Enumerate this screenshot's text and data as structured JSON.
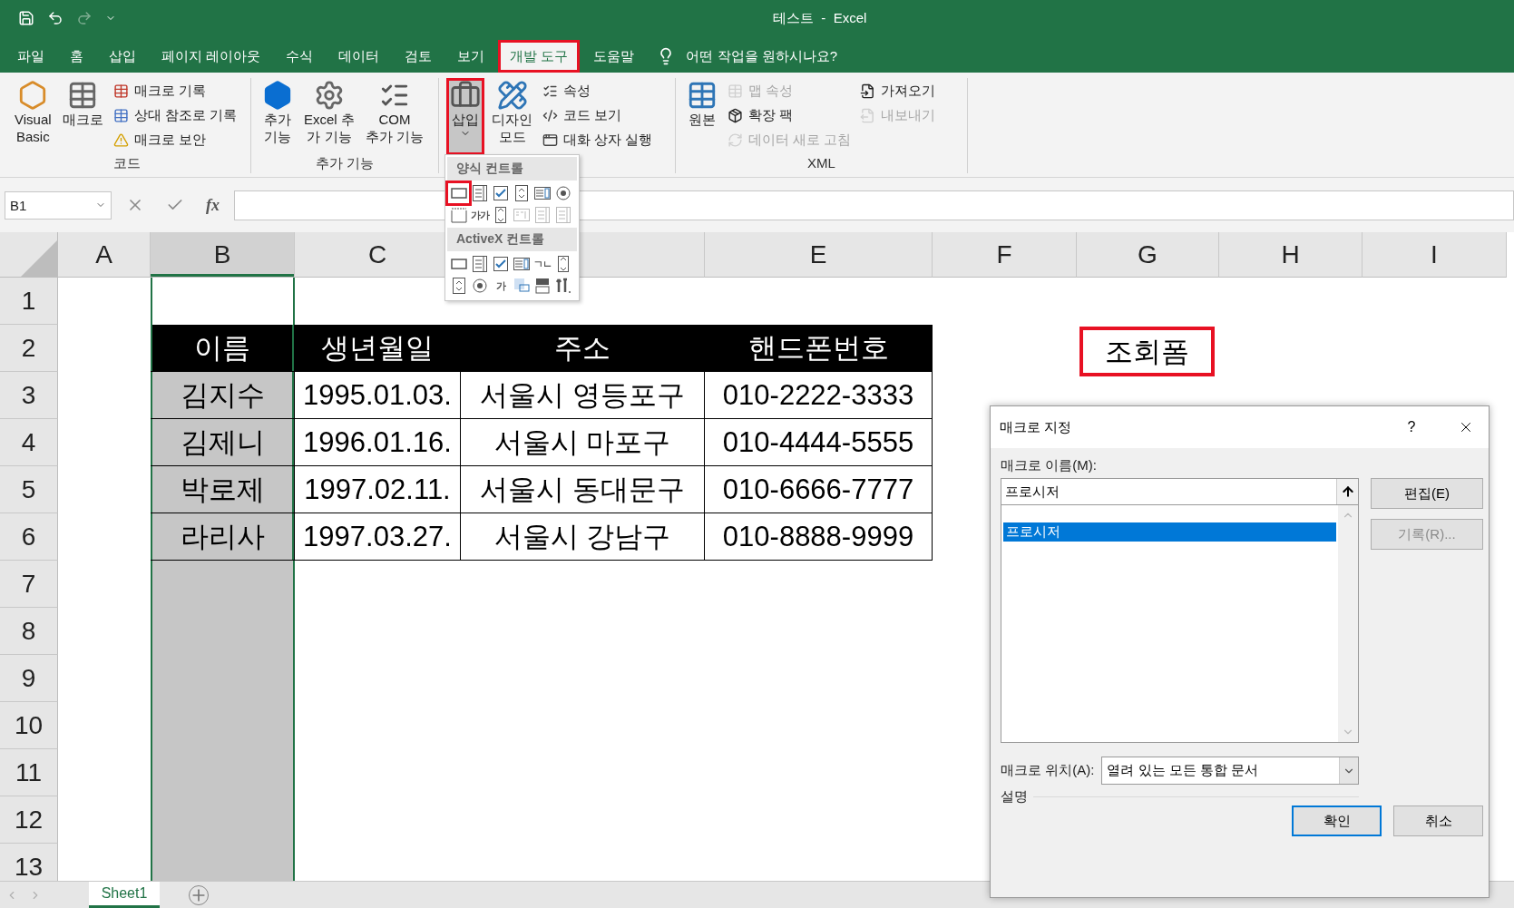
{
  "title_bar": {
    "title": "테스트  -  Excel"
  },
  "menu_tabs": [
    {
      "label": "파일",
      "selected": false,
      "highlighted": false
    },
    {
      "label": "홈",
      "selected": false,
      "highlighted": false
    },
    {
      "label": "삽입",
      "selected": false,
      "highlighted": false
    },
    {
      "label": "페이지 레이아웃",
      "selected": false,
      "highlighted": false
    },
    {
      "label": "수식",
      "selected": false,
      "highlighted": false
    },
    {
      "label": "데이터",
      "selected": false,
      "highlighted": false
    },
    {
      "label": "검토",
      "selected": false,
      "highlighted": false
    },
    {
      "label": "보기",
      "selected": false,
      "highlighted": false
    },
    {
      "label": "개발 도구",
      "selected": true,
      "highlighted": true
    },
    {
      "label": "도움말",
      "selected": false,
      "highlighted": false
    }
  ],
  "tell_me": "어떤 작업을 원하시나요?",
  "ribbon_groups": [
    {
      "label": "코드",
      "columns": [
        {
          "kind": "large",
          "label": "Visual\nBasic"
        },
        {
          "kind": "large",
          "label": "매크로"
        },
        {
          "kind": "stack",
          "items": [
            {
              "label": "매크로 기록",
              "disabled": false
            },
            {
              "label": "상대 참조로 기록",
              "disabled": false
            },
            {
              "label": "매크로 보안",
              "disabled": false
            }
          ]
        }
      ]
    },
    {
      "label": "추가 기능",
      "columns": [
        {
          "kind": "large",
          "label": "추가\n기능"
        },
        {
          "kind": "large",
          "label": "Excel 추\n가 기능"
        },
        {
          "kind": "large",
          "label": "COM\n추가 기능"
        }
      ]
    },
    {
      "columns": [
        {
          "kind": "large",
          "label": "삽입",
          "dropdown": true,
          "pressed": true,
          "highlighted": true
        },
        {
          "kind": "large",
          "label": "디자인\n모드"
        },
        {
          "kind": "stack",
          "items": [
            {
              "label": "속성",
              "disabled": false
            },
            {
              "label": "코드 보기",
              "disabled": false
            },
            {
              "label": "대화 상자 실행",
              "disabled": false
            }
          ]
        }
      ]
    },
    {
      "label": "XML",
      "columns": [
        {
          "kind": "large",
          "label": "원본"
        },
        {
          "kind": "stack",
          "items": [
            {
              "label": "맵 속성",
              "disabled": true
            },
            {
              "label": "확장 팩",
              "disabled": false
            },
            {
              "label": "데이터 새로 고침",
              "disabled": true
            }
          ]
        },
        {
          "kind": "stack",
          "items": [
            {
              "label": "가져오기",
              "disabled": false
            },
            {
              "label": "내보내기",
              "disabled": true
            }
          ]
        }
      ]
    }
  ],
  "formula_bar": {
    "name_box": "B1",
    "fx": "fx"
  },
  "sheet": {
    "columns": [
      {
        "label": "A",
        "selected": false
      },
      {
        "label": "B",
        "selected": true
      },
      {
        "label": "C",
        "selected": false
      },
      {
        "selected": false
      },
      {
        "label": "E",
        "selected": false
      },
      {
        "label": "F",
        "selected": false
      },
      {
        "label": "G",
        "selected": false
      },
      {
        "label": "H",
        "selected": false
      },
      {
        "label": "I",
        "selected": false
      }
    ],
    "rows": [
      "1",
      "2",
      "3",
      "4",
      "5",
      "6",
      "7",
      "8",
      "9",
      "10",
      "11",
      "12",
      "13"
    ],
    "table": {
      "header": [
        "이름",
        "생년월일",
        "주소",
        "핸드폰번호"
      ],
      "rows": [
        [
          "김지수",
          "1995.01.03.",
          "서울시 영등포구",
          "010-2222-3333"
        ],
        [
          "김제니",
          "1996.01.16.",
          "서울시 마포구",
          "010-4444-5555"
        ],
        [
          "박로제",
          "1997.02.11.",
          "서울시 동대문구",
          "010-6666-7777"
        ],
        [
          "라리사",
          "1997.03.27.",
          "서울시 강남구",
          "010-8888-9999"
        ]
      ]
    },
    "form_button": {
      "label": "조회폼",
      "highlighted": true
    }
  },
  "insert_menu": {
    "sections": [
      {
        "title": "양식 컨트롤",
        "controls": [
          {
            "kind": "button",
            "disabled": false,
            "highlighted": true
          },
          {
            "kind": "combo",
            "disabled": false,
            "highlighted": false
          },
          {
            "kind": "checkbox",
            "disabled": false,
            "highlighted": false
          },
          {
            "kind": "spin",
            "disabled": false,
            "highlighted": false
          },
          {
            "kind": "listbox",
            "disabled": false,
            "highlighted": false
          },
          {
            "kind": "option",
            "disabled": false,
            "highlighted": false
          },
          {
            "kind": "group",
            "disabled": false,
            "highlighted": false
          },
          {
            "kind": "label",
            "glyph": "가가",
            "disabled": false,
            "highlighted": false
          },
          {
            "kind": "scroll",
            "disabled": false,
            "highlighted": false
          },
          {
            "kind": "textbox",
            "disabled": true,
            "highlighted": false
          },
          {
            "kind": "combo",
            "disabled": true,
            "highlighted": false
          },
          {
            "kind": "combo",
            "disabled": true,
            "highlighted": false
          }
        ]
      },
      {
        "title": "ActiveX 컨트롤",
        "controls": [
          {
            "kind": "button",
            "disabled": false,
            "highlighted": false
          },
          {
            "kind": "combo",
            "disabled": false,
            "highlighted": false
          },
          {
            "kind": "checkbox",
            "disabled": false,
            "highlighted": false
          },
          {
            "kind": "listbox",
            "disabled": false,
            "highlighted": false
          },
          {
            "kind": "textbox",
            "glyph": "ㄱㄴ",
            "disabled": false,
            "highlighted": false
          },
          {
            "kind": "scroll",
            "disabled": false,
            "highlighted": false
          },
          {
            "kind": "spin",
            "disabled": false,
            "highlighted": false
          },
          {
            "kind": "option",
            "disabled": false,
            "highlighted": false
          },
          {
            "kind": "label",
            "glyph": "가",
            "disabled": false,
            "highlighted": false
          },
          {
            "kind": "image",
            "disabled": false,
            "highlighted": false
          },
          {
            "kind": "toggle",
            "disabled": false,
            "highlighted": false
          },
          {
            "kind": "more",
            "disabled": false,
            "highlighted": false
          }
        ]
      }
    ]
  },
  "dialog": {
    "title": "매크로 지정",
    "help": "?",
    "name_label": "매크로 이름(M):",
    "name_value": "프로시저",
    "macros": [
      {
        "label": "프로시저",
        "selected": true
      }
    ],
    "side_buttons": [
      {
        "label": "편집(E)",
        "disabled": false
      },
      {
        "label": "기록(R)...",
        "disabled": true
      }
    ],
    "location_label": "매크로 위치(A):",
    "location_value": "열려 있는 모든 통합 문서",
    "description_label": "설명",
    "buttons": [
      {
        "label": "확인",
        "default": true
      },
      {
        "label": "취소",
        "default": false
      }
    ]
  },
  "sheet_tabs": [
    {
      "label": "Sheet1",
      "selected": true
    }
  ]
}
